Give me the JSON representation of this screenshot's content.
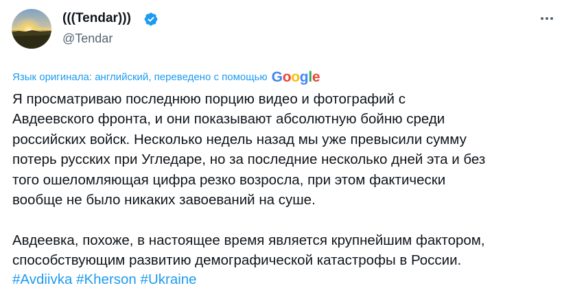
{
  "author": {
    "display_name": "(((Tendar)))",
    "handle": "@Tendar",
    "verified": true
  },
  "icons": {
    "verified": "verified-badge-icon",
    "more": "more-horizontal-icon"
  },
  "translation": {
    "label": "Язык оригинала: английский, переведено с помощью",
    "provider_letters": [
      "G",
      "o",
      "o",
      "g",
      "l",
      "e"
    ],
    "provider_colors": [
      "#4285F4",
      "#EA4335",
      "#FBBC05",
      "#4285F4",
      "#34A853",
      "#EA4335"
    ]
  },
  "tweet": {
    "paragraph_1_lines": [
      "Я просматриваю последнюю порцию видео и фотографий с",
      "Авдеевского фронта, и они показывают абсолютную бойню среди",
      "российских войск. Несколько недель назад мы уже превысили сумму",
      "потерь русских при Угледаре, но за последние несколько дней эта и без",
      "того ошеломляющая цифра резко возросла, при этом фактически",
      "вообще не было никаких завоеваний на суше."
    ],
    "paragraph_2_lines": [
      "Авдеевка, похоже, в настоящее время является крупнейшим фактором,",
      "способствующим развитию демографической катастрофы в России."
    ],
    "hashtags": [
      "#Avdiivka",
      "#Kherson",
      "#Ukraine"
    ]
  },
  "colors": {
    "text": "#0f1419",
    "secondary": "#536471",
    "link": "#1d9bf0"
  }
}
